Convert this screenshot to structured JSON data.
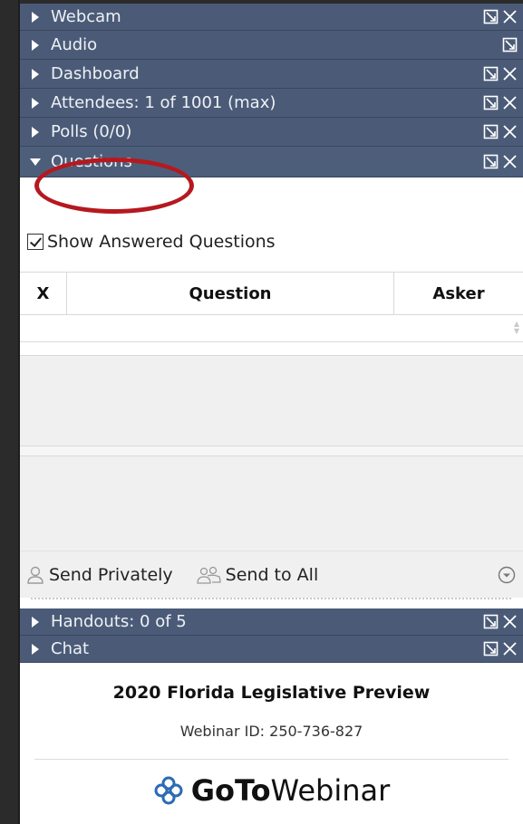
{
  "sections": {
    "webcam": {
      "label": "Webcam"
    },
    "audio": {
      "label": "Audio"
    },
    "dashboard": {
      "label": "Dashboard"
    },
    "attendees": {
      "label": "Attendees:  1 of 1001 (max)"
    },
    "polls": {
      "label": "Polls (0/0)"
    },
    "questions": {
      "label": "Questions"
    },
    "handouts": {
      "label": "Handouts: 0 of 5"
    },
    "chat": {
      "label": "Chat"
    }
  },
  "questions_panel": {
    "show_answered_label": "Show Answered Questions",
    "show_answered_checked": true,
    "columns": {
      "x": "X",
      "question": "Question",
      "asker": "Asker"
    },
    "send_privately_label": "Send Privately",
    "send_to_all_label": "Send to All"
  },
  "footer": {
    "title": "2020 Florida Legislative Preview",
    "webinar_id": "Webinar ID: 250-736-827",
    "brand_bold": "GoTo",
    "brand_regular": "Webinar"
  },
  "colors": {
    "section_bar": "#4b5b77",
    "highlight": "#b5191f",
    "brand_blue": "#2b6bb5"
  },
  "icons": {
    "expand": "triangle-right-icon",
    "collapse": "triangle-down-icon",
    "popout": "popout-icon",
    "close": "close-icon",
    "person": "person-icon",
    "group": "group-icon",
    "dropdown": "chevron-down-circle-icon",
    "logo": "gotowebinar-logo-icon"
  }
}
